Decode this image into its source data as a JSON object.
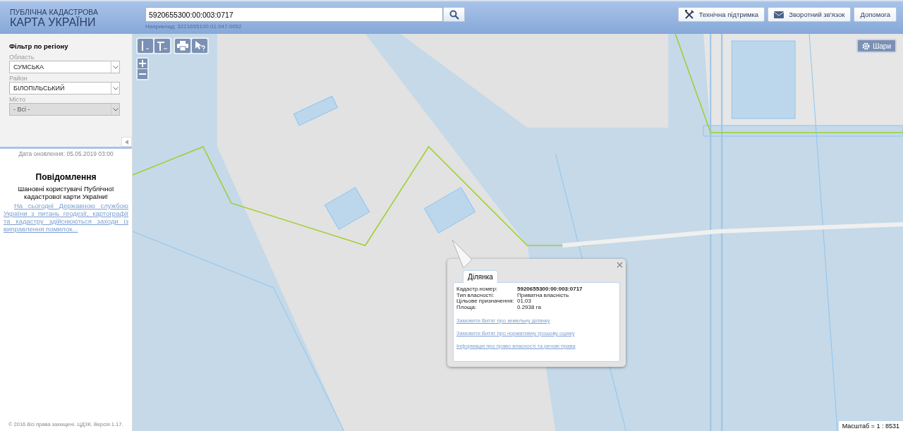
{
  "header": {
    "logo_line1": "ПУБЛІЧНА КАДАСТРОВА",
    "logo_line2": "КАРТА УКРАЇНИ",
    "search": {
      "value": "5920655300:00:003:0717",
      "hint": "Наприклад: 3221655100:01:047:0052"
    },
    "buttons": [
      {
        "label": "Технічна підтримка",
        "kind": "tools"
      },
      {
        "label": "Зворотний зв'язок",
        "kind": "mail"
      },
      {
        "label": "Допомога",
        "kind": "plain"
      }
    ]
  },
  "filter": {
    "title": "Фільтр по регіону",
    "fields": [
      {
        "label": "Область",
        "value": "СУМСЬКА",
        "disabled": false
      },
      {
        "label": "Район",
        "value": "БІЛОПІЛЬСЬКИЙ",
        "disabled": false
      },
      {
        "label": "Місто",
        "value": "- Всі -",
        "disabled": true
      }
    ]
  },
  "update_date": "Дата оновлення: 05.05.2019 03:00",
  "notice": {
    "title": "Повідомлення",
    "greeting": "Шановні користувачі Публічної кадастрової карти України!",
    "link": "На сьогодні Державною службою України з питань геодезії, картографії та кадастру здійснюються заходи із виправлення помилок..."
  },
  "copyright": "© 2016 Всі права захищені. ЦДЗК. Версія 1.17.",
  "map": {
    "layers_button": "Шари",
    "scale": "Масштаб = 1 : 8531",
    "popup": {
      "tab": "Ділянка",
      "fields": [
        {
          "label": "Кадастр.номер:",
          "value": "5920655300:00:003:0717",
          "bold": true
        },
        {
          "label": "Тип власності:",
          "value": "Приватна власність",
          "bold": false
        },
        {
          "label": "Цільове призначення:",
          "value": "01.03",
          "bold": false
        },
        {
          "label": "Площа:",
          "value": "0.2938 га",
          "bold": false
        }
      ],
      "links": [
        "Замовити Витяг про земельну ділянку",
        "Замовити Витяг про нормативну грошову оцінку",
        "Інформація про право власності та речові права"
      ]
    }
  }
}
